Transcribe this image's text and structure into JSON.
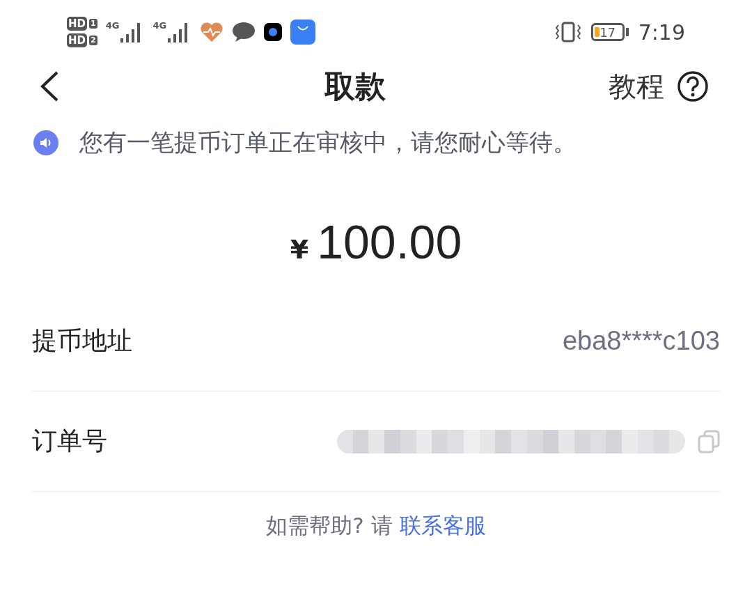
{
  "status_bar": {
    "sims": [
      {
        "label": "HD",
        "slot": "1"
      },
      {
        "label": "HD",
        "slot": "2"
      }
    ],
    "networks": [
      {
        "label": "4G"
      },
      {
        "label": "4G"
      }
    ],
    "battery": {
      "level": 0.17,
      "label": "17"
    },
    "time": "7:19"
  },
  "header": {
    "title": "取款",
    "tutorial": "教程"
  },
  "notice": "您有一笔提币订单正在审核中，请您耐心等待。",
  "amount": {
    "currency": "¥",
    "value": "100.00"
  },
  "rows": [
    {
      "label": "提币地址",
      "value": "eba8****c103",
      "kind": "text"
    },
    {
      "label": "订单号",
      "kind": "redacted"
    }
  ],
  "help": {
    "text": "如需帮助? 请",
    "link": "联系客服"
  }
}
